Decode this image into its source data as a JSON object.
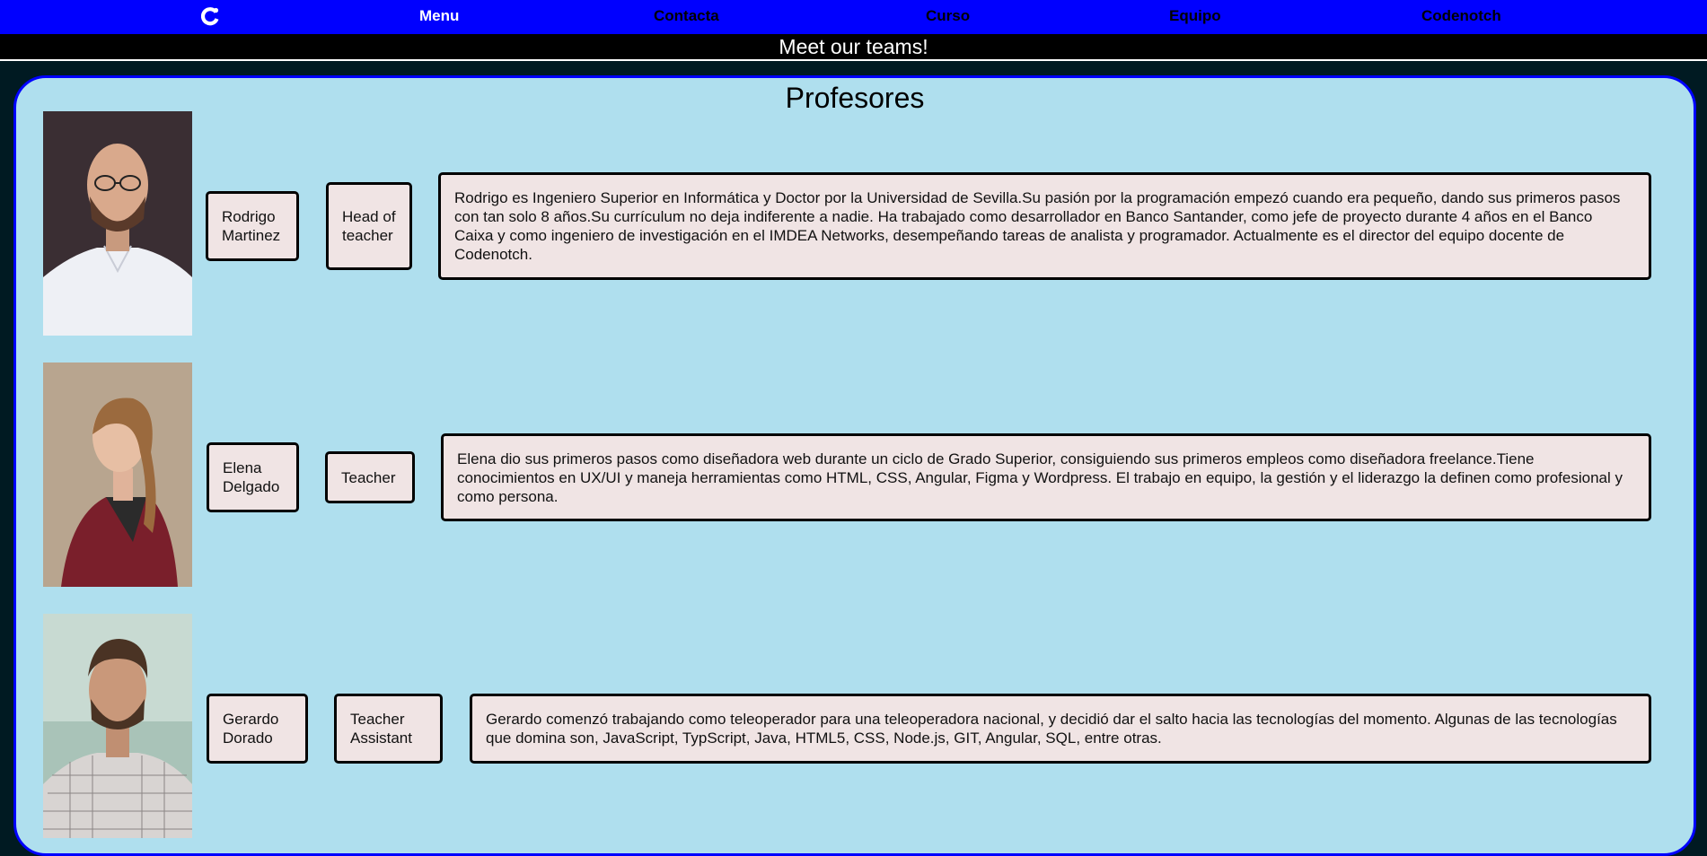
{
  "nav": {
    "logo_icon": "codenotch-logo-icon",
    "items": [
      {
        "label": "Menu",
        "active": true
      },
      {
        "label": "Contacta",
        "active": false
      },
      {
        "label": "Curso",
        "active": false
      },
      {
        "label": "Equipo",
        "active": false
      },
      {
        "label": "Codenotch",
        "active": false
      }
    ]
  },
  "subheader": "Meet our teams!",
  "section_title": "Profesores",
  "teachers": [
    {
      "name": "Rodrigo Martinez",
      "role": "Head of teacher",
      "bio": "Rodrigo es Ingeniero Superior en Informática y Doctor por la Universidad de Sevilla.Su pasión por la programación empezó cuando era pequeño, dando sus primeros pasos con tan solo 8 años.Su currículum no deja indiferente a nadie. Ha trabajado como desarrollador en Banco Santander, como jefe de proyecto durante 4 años en el Banco Caixa y como ingeniero de investigación en el IMDEA Networks, desempeñando tareas de analista y programador. Actualmente es el director del equipo docente de Codenotch."
    },
    {
      "name": "Elena Delgado",
      "role": "Teacher",
      "bio": "Elena dio sus primeros pasos como diseñadora web durante un ciclo de Grado Superior, consiguiendo sus primeros empleos como diseñadora freelance.Tiene conocimientos en UX/UI y maneja herramientas como HTML, CSS, Angular, Figma y Wordpress. El trabajo en equipo, la gestión y el liderazgo la definen como profesional y como persona."
    },
    {
      "name": "Gerardo Dorado",
      "role": "Teacher Assistant",
      "bio": "Gerardo comenzó trabajando como teleoperador para una teleoperadora nacional, y decidió dar el salto hacia las tecnologías del momento. Algunas de las tecnologías que domina son, JavaScript, TypScript, Java, HTML5, CSS, Node.js, GIT, Angular, SQL, entre otras."
    }
  ],
  "colors": {
    "nav_bg": "#0000ff",
    "panel_bg": "#afdfee",
    "box_bg": "#f0e4e4"
  }
}
